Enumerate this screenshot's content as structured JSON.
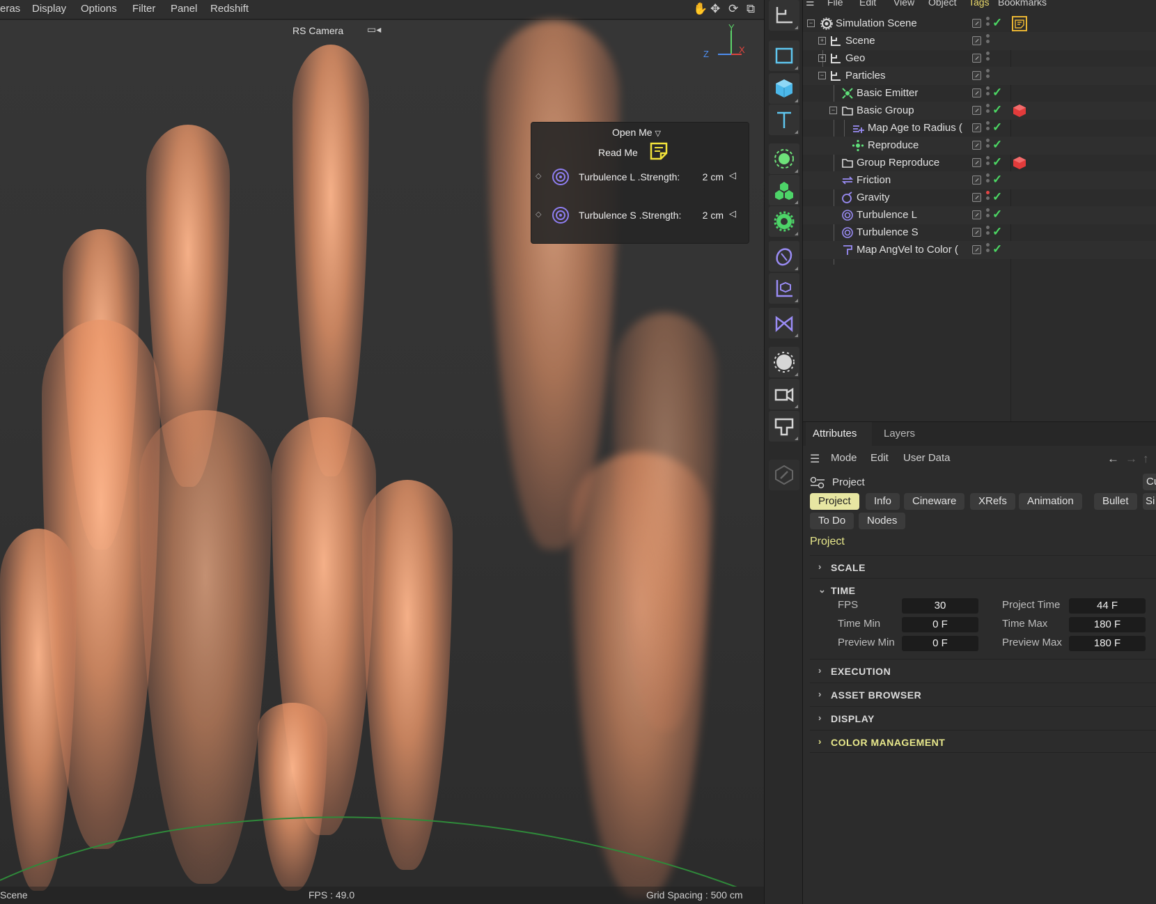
{
  "viewport": {
    "menu": [
      "eras",
      "Display",
      "Options",
      "Filter",
      "Panel",
      "Redshift"
    ],
    "camera_label": "RS Camera",
    "axes": {
      "y": "Y",
      "z": "Z",
      "x": "X"
    },
    "overlay": {
      "open_me": "Open Me",
      "read_me": "Read Me",
      "turbulence_l_label": "Turbulence L .Strength:",
      "turbulence_l_value": "2 cm",
      "turbulence_s_label": "Turbulence S .Strength:",
      "turbulence_s_value": "2 cm"
    },
    "status": {
      "left": "Scene",
      "fps": "FPS : 49.0",
      "grid": "Grid Spacing : 500 cm"
    }
  },
  "object_manager": {
    "menu": [
      "File",
      "Edit",
      "View",
      "Object",
      "Tags",
      "Bookmarks"
    ],
    "active_menu": "Tags",
    "objects": [
      {
        "name": "Simulation Scene",
        "icon": "simulation-scene-icon",
        "tag": "note-tag"
      },
      {
        "name": "Scene",
        "icon": "null-icon"
      },
      {
        "name": "Geo",
        "icon": "null-icon"
      },
      {
        "name": "Particles",
        "icon": "null-icon"
      },
      {
        "name": "Basic Emitter",
        "icon": "emitter-icon"
      },
      {
        "name": "Basic Group",
        "icon": "folder-icon",
        "tag": "red-cube-tag"
      },
      {
        "name": "Map Age to Radius (",
        "icon": "map-icon"
      },
      {
        "name": "Reproduce",
        "icon": "reproduce-icon"
      },
      {
        "name": "Group Reproduce",
        "icon": "folder-icon",
        "tag": "red-cube-tag"
      },
      {
        "name": "Friction",
        "icon": "friction-icon"
      },
      {
        "name": "Gravity",
        "icon": "gravity-icon"
      },
      {
        "name": "Turbulence L",
        "icon": "turbulence-icon"
      },
      {
        "name": "Turbulence S",
        "icon": "turbulence-icon"
      },
      {
        "name": "Map AngVel to Color (",
        "icon": "map-color-icon"
      }
    ]
  },
  "attributes": {
    "tabs": [
      "Attributes",
      "Layers"
    ],
    "menu": [
      "Mode",
      "Edit",
      "User Data"
    ],
    "header": "Project",
    "header_right": "Cu",
    "chips_row1": [
      "Project",
      "Info",
      "Cineware",
      "XRefs",
      "Animation",
      "Bullet",
      "Si"
    ],
    "chips_row2": [
      "To Do",
      "Nodes"
    ],
    "section_title": "Project",
    "sections": {
      "scale": "SCALE",
      "time": "TIME",
      "execution": "EXECUTION",
      "asset_browser": "ASSET BROWSER",
      "display": "DISPLAY",
      "color_management": "COLOR MANAGEMENT"
    },
    "time": {
      "fps_label": "FPS",
      "fps_value": "30",
      "project_time_label": "Project Time",
      "project_time_value": "44 F",
      "time_min_label": "Time Min",
      "time_min_value": "0 F",
      "time_max_label": "Time Max",
      "time_max_value": "180 F",
      "preview_min_label": "Preview Min",
      "preview_min_value": "0 F",
      "preview_max_label": "Preview Max",
      "preview_max_value": "180 F"
    }
  },
  "colors": {
    "accent": "#e7e6a2",
    "check": "#4cd964",
    "tag_red": "#e23b3b"
  }
}
